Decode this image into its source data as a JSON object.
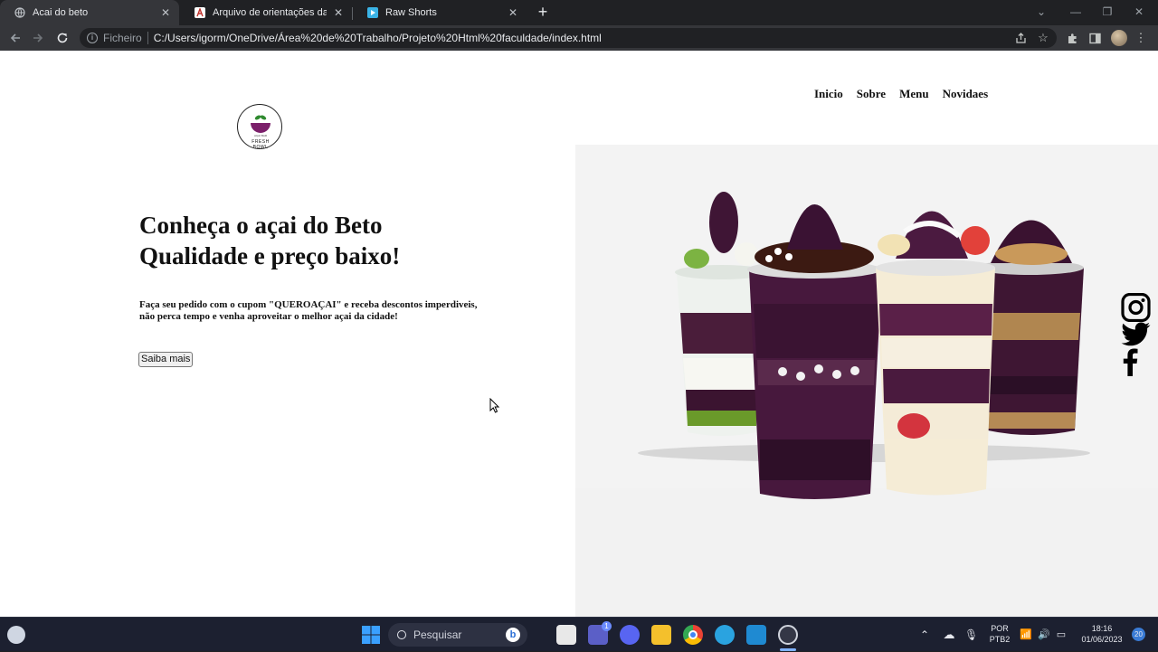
{
  "browser": {
    "tabs": [
      {
        "title": "Acai do beto",
        "favicon": "globe-icon",
        "active": true
      },
      {
        "title": "Arquivo de orientações da ativid",
        "favicon": "document-a-icon",
        "active": false
      },
      {
        "title": "Raw Shorts",
        "favicon": "play-icon",
        "active": false
      }
    ],
    "new_tab_symbol": "+",
    "address_scheme": "Ficheiro",
    "url": "C:/Users/igorm/OneDrive/Área%20de%20Trabalho/Projeto%20Html%20faculdade/index.html"
  },
  "page": {
    "nav": [
      "Inicio",
      "Sobre",
      "Menu",
      "Novidaes"
    ],
    "logo_text": "FRESH BOWL",
    "headline_line1": "Conheça o açai do Beto",
    "headline_line2": "Qualidade e preço baixo!",
    "lead_line1": "Faça seu pedido com o cupom \"QUEROAÇAI\" e receba descontos imperdiveis,",
    "lead_line2": "não perca tempo e venha aproveitar o melhor açai da cidade!",
    "cta_label": "Saiba mais",
    "social": [
      "instagram-icon",
      "twitter-icon",
      "facebook-icon"
    ]
  },
  "taskbar": {
    "search_label": "Pesquisar",
    "language_line1": "POR",
    "language_line2": "PTB2",
    "time": "18:16",
    "date": "01/06/2023",
    "notifications": "20",
    "teams_badge": "1"
  }
}
